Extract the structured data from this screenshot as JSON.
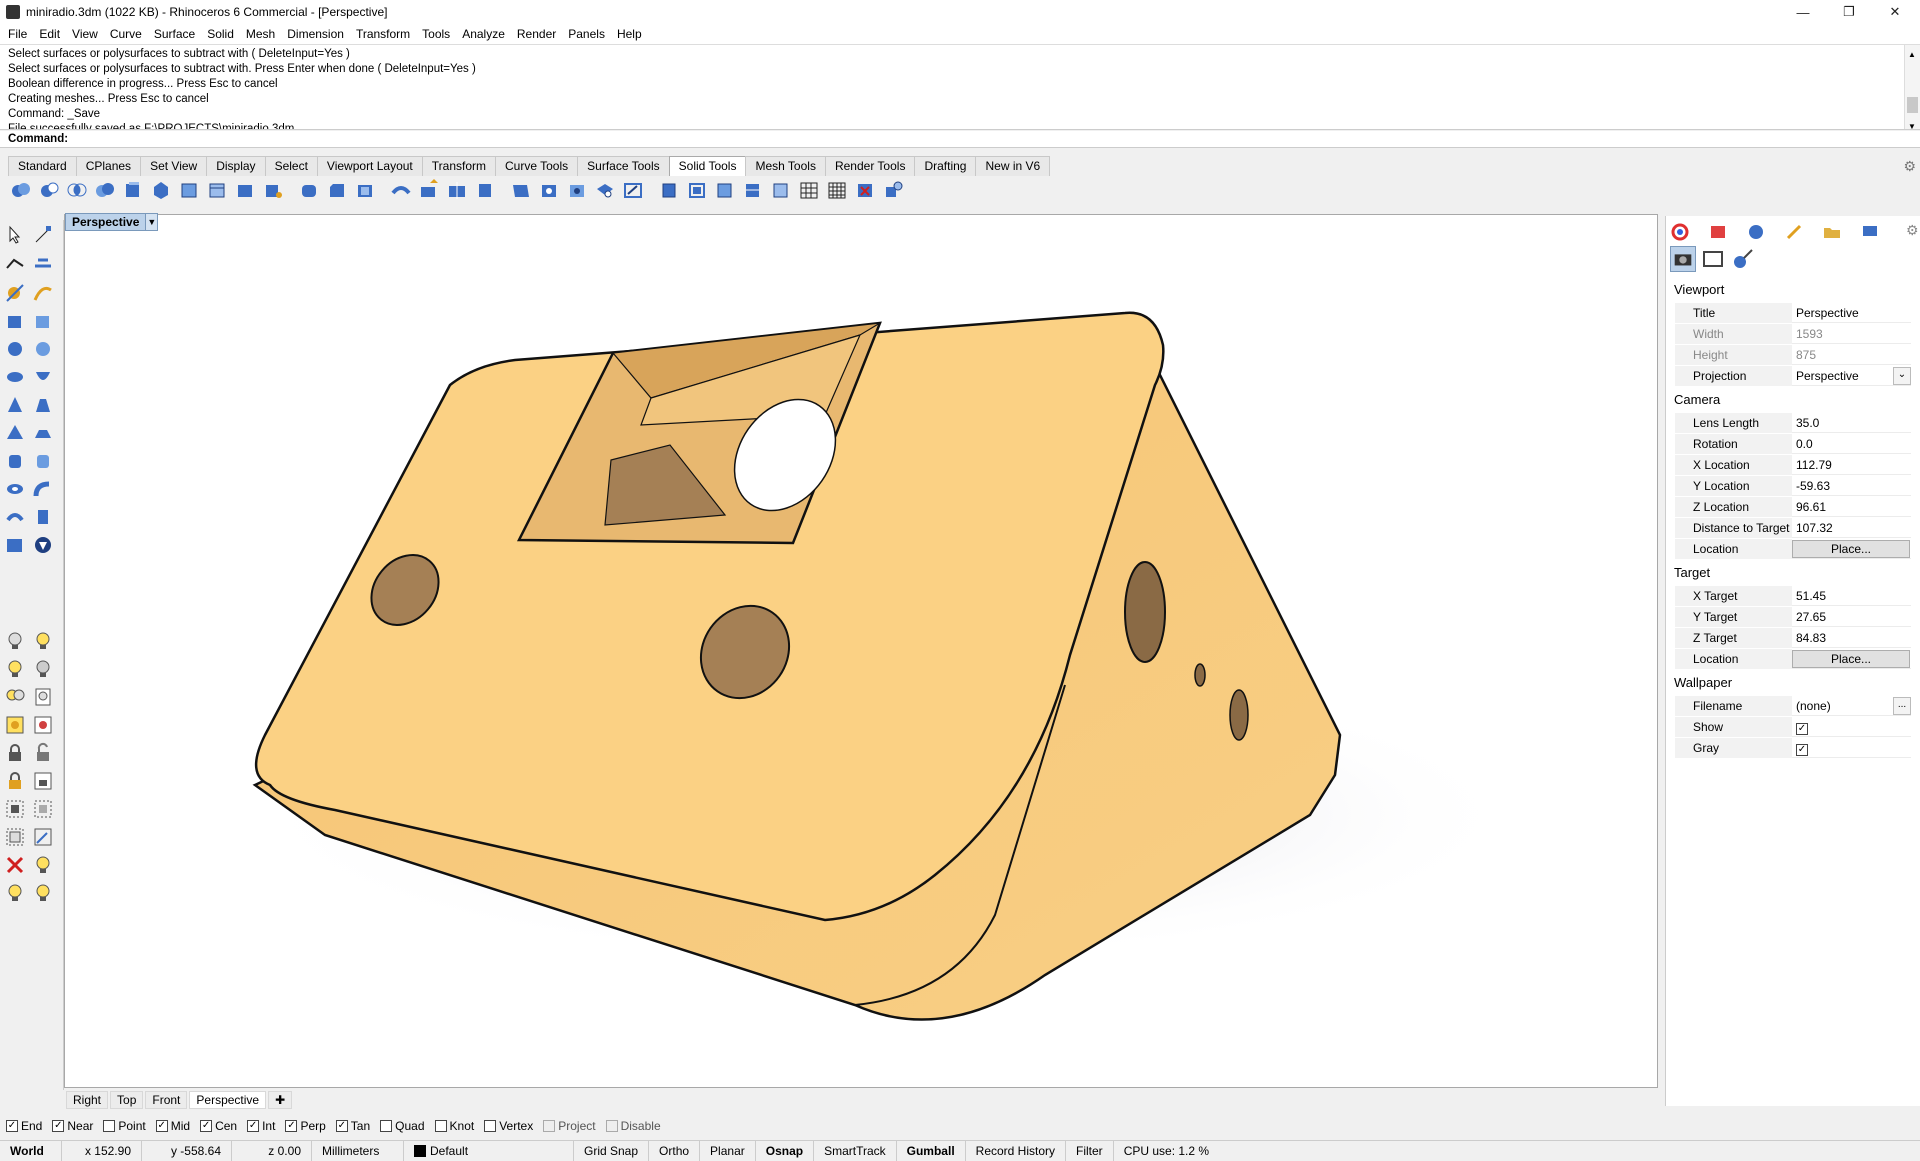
{
  "window": {
    "title": "miniradio.3dm (1022 KB) - Rhinoceros 6 Commercial - [Perspective]"
  },
  "menu": [
    "File",
    "Edit",
    "View",
    "Curve",
    "Surface",
    "Solid",
    "Mesh",
    "Dimension",
    "Transform",
    "Tools",
    "Analyze",
    "Render",
    "Panels",
    "Help"
  ],
  "history": [
    "Select surfaces or polysurfaces to subtract with ( DeleteInput=Yes )",
    "Select surfaces or polysurfaces to subtract with. Press Enter when done ( DeleteInput=Yes )",
    "Boolean difference in progress... Press Esc to cancel",
    "Creating meshes... Press Esc to cancel",
    "Command: _Save",
    "File successfully saved as F:\\PROJECTS\\miniradio.3dm."
  ],
  "command_prompt": "Command:",
  "toolbar_tabs": [
    "Standard",
    "CPlanes",
    "Set View",
    "Display",
    "Select",
    "Viewport Layout",
    "Transform",
    "Curve Tools",
    "Surface Tools",
    "Solid Tools",
    "Mesh Tools",
    "Render Tools",
    "Drafting",
    "New in V6"
  ],
  "active_toolbar_tab": "Solid Tools",
  "viewport": {
    "label": "Perspective"
  },
  "viewport_tabs": [
    "Right",
    "Top",
    "Front",
    "Perspective"
  ],
  "osnaps": [
    {
      "label": "End",
      "checked": true
    },
    {
      "label": "Near",
      "checked": true
    },
    {
      "label": "Point",
      "checked": false
    },
    {
      "label": "Mid",
      "checked": true
    },
    {
      "label": "Cen",
      "checked": true
    },
    {
      "label": "Int",
      "checked": true
    },
    {
      "label": "Perp",
      "checked": true
    },
    {
      "label": "Tan",
      "checked": true
    },
    {
      "label": "Quad",
      "checked": false
    },
    {
      "label": "Knot",
      "checked": false
    },
    {
      "label": "Vertex",
      "checked": false
    },
    {
      "label": "Project",
      "checked": false
    },
    {
      "label": "Disable",
      "checked": false
    }
  ],
  "status": {
    "cplane": "World",
    "x": "x 152.90",
    "y": "y -558.64",
    "z": "z 0.00",
    "units": "Millimeters",
    "layer": "Default",
    "grid_snap": "Grid Snap",
    "ortho": "Ortho",
    "planar": "Planar",
    "osnap": "Osnap",
    "smarttrack": "SmartTrack",
    "gumball": "Gumball",
    "record_history": "Record History",
    "filter": "Filter",
    "cpu": "CPU use: 1.2 %"
  },
  "properties": {
    "viewport_header": "Viewport",
    "title_label": "Title",
    "title_value": "Perspective",
    "width_label": "Width",
    "width_value": "1593",
    "height_label": "Height",
    "height_value": "875",
    "projection_label": "Projection",
    "projection_value": "Perspective",
    "camera_header": "Camera",
    "lens_label": "Lens Length",
    "lens_value": "35.0",
    "rotation_label": "Rotation",
    "rotation_value": "0.0",
    "xloc_label": "X Location",
    "xloc_value": "112.79",
    "yloc_label": "Y Location",
    "yloc_value": "-59.63",
    "zloc_label": "Z Location",
    "zloc_value": "96.61",
    "dist_label": "Distance to Target",
    "dist_value": "107.32",
    "location_label": "Location",
    "place_button": "Place...",
    "target_header": "Target",
    "xt_label": "X Target",
    "xt_value": "51.45",
    "yt_label": "Y Target",
    "yt_value": "27.65",
    "zt_label": "Z Target",
    "zt_value": "84.83",
    "wallpaper_header": "Wallpaper",
    "filename_label": "Filename",
    "filename_value": "(none)",
    "show_label": "Show",
    "gray_label": "Gray",
    "dots": "..."
  },
  "colors": {
    "model_fill": "#fbd184",
    "model_edge": "#111111",
    "accent": "#bcd2ea"
  }
}
